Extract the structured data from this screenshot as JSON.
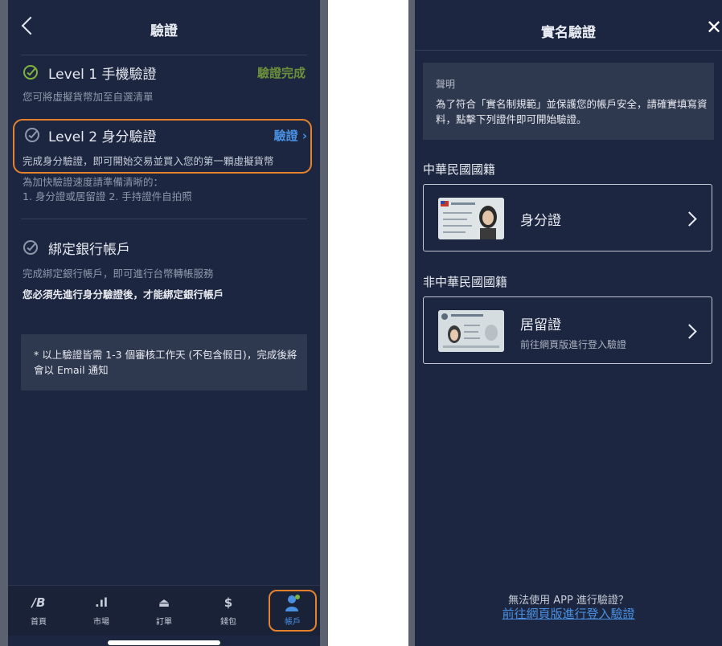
{
  "left_screen": {
    "header": {
      "title": "驗證"
    },
    "level1": {
      "title": "Level 1 手機驗證",
      "status": "驗證完成",
      "description": "您可將虛擬貨幣加至自選清單"
    },
    "level2": {
      "title": "Level 2 身分驗證",
      "action": "驗證",
      "description": "完成身分驗證，即可開始交易並買入您的第一顆虛擬貨幣",
      "hint_line1": "為加快驗證速度請準備清晰的：",
      "hint_line2": "1. 身分證或居留證 2. 手持證件自拍照"
    },
    "bank": {
      "title": "綁定銀行帳戶",
      "description": "完成綁定銀行帳戶，即可進行台幣轉帳服務",
      "warning": "您必須先進行身分驗證後，才能綁定銀行帳戶"
    },
    "notice": "* 以上驗證皆需 1-3 個審核工作天 (不包含假日)，完成後將會以 Email 通知",
    "tabbar": [
      {
        "label": "首頁",
        "icon": "home-logo-icon",
        "glyph": "∕B"
      },
      {
        "label": "市場",
        "icon": "signal-bars-icon",
        "glyph": ".ıl"
      },
      {
        "label": "訂單",
        "icon": "inbox-icon",
        "glyph": "⏏"
      },
      {
        "label": "錢包",
        "icon": "dollar-icon",
        "glyph": "$"
      },
      {
        "label": "帳戶",
        "icon": "user-icon",
        "glyph": "●"
      }
    ]
  },
  "right_screen": {
    "header": {
      "title": "實名驗證"
    },
    "declaration": {
      "heading": "聲明",
      "text": "為了符合「實名制規範」並保護您的帳戶安全，請確實填寫資料，點擊下列證件即可開始驗證。"
    },
    "section_citizen": "中華民國國籍",
    "id_card": {
      "title": "身分證"
    },
    "section_foreign": "非中華民國國籍",
    "residence_card": {
      "title": "居留證",
      "subtitle": "前往網頁版進行登入驗證"
    },
    "footer": {
      "question": "無法使用 APP 進行驗證？",
      "link": "前往網頁版進行登入驗證"
    }
  },
  "colors": {
    "accent": "#4a90e2",
    "highlight": "#e5822c",
    "done": "#6b8f3a",
    "background": "#1c2640"
  }
}
